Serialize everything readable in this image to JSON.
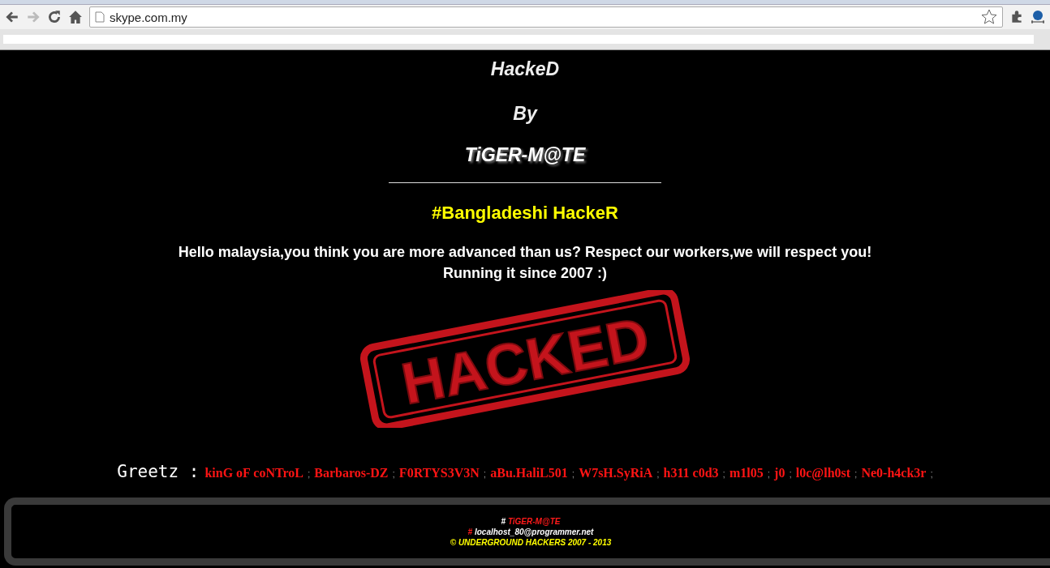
{
  "browser": {
    "url": "skype.com.my"
  },
  "page": {
    "title": "HackeD",
    "by": "By",
    "author": "TiGER-M@TE",
    "tagline": "#Bangladeshi HackeR",
    "message": [
      "Hello malaysia,you think you are more advanced than us? Respect our workers,we will respect you!",
      "Running it since 2007 :)"
    ],
    "stamp_text": "HACKED",
    "greetz_label": "Greetz :",
    "separator": ";",
    "greetz": [
      "kinG oF coNTroL",
      "Barbaros-DZ",
      "F0RTYS3V3N",
      "aBu.HaliL501",
      "W7sH.SyRiA",
      "h311 c0d3",
      "m1l05",
      "j0",
      "l0c@lh0st",
      "Ne0-h4ck3r"
    ]
  },
  "footer": {
    "lines": [
      {
        "kind": "credit",
        "hash": "#",
        "text": "TiGER-M@TE"
      },
      {
        "kind": "contact",
        "hash": "#",
        "text": "localhost_80@programmer.net"
      }
    ],
    "copyright": "© UNDERGROUND HACKERS 2007 - 2013"
  }
}
